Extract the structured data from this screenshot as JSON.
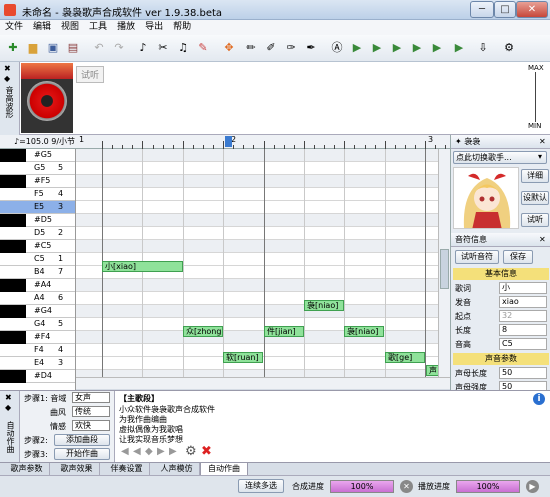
{
  "window": {
    "title": "未命名 - 袅袅歌声合成软件 ver 1.9.38.beta",
    "min": "─",
    "max": "□",
    "close": "✕"
  },
  "menu": [
    "文件",
    "编辑",
    "视图",
    "工具",
    "播放",
    "导出",
    "帮助"
  ],
  "wave": {
    "side_label": "音高波形",
    "audition_label": "试听",
    "max_label": "MAX",
    "min_label": "MIN"
  },
  "ruler": {
    "tempo": "♪=105.0  9/小节",
    "bars": [
      "1",
      "2",
      "3"
    ]
  },
  "piano_keys": [
    {
      "name": "#G5",
      "num": "",
      "black": true
    },
    {
      "name": "G5",
      "num": "5",
      "black": false
    },
    {
      "name": "#F5",
      "num": "",
      "black": true
    },
    {
      "name": "F5",
      "num": "4",
      "black": false
    },
    {
      "name": "E5",
      "num": "3",
      "black": false,
      "hl": true
    },
    {
      "name": "#D5",
      "num": "",
      "black": true
    },
    {
      "name": "D5",
      "num": "2",
      "black": false
    },
    {
      "name": "#C5",
      "num": "",
      "black": true
    },
    {
      "name": "C5",
      "num": "1",
      "black": false
    },
    {
      "name": "B4",
      "num": "7",
      "black": false
    },
    {
      "name": "#A4",
      "num": "",
      "black": true
    },
    {
      "name": "A4",
      "num": "6",
      "black": false
    },
    {
      "name": "#G4",
      "num": "",
      "black": true
    },
    {
      "name": "G4",
      "num": "5",
      "black": false
    },
    {
      "name": "#F4",
      "num": "",
      "black": true
    },
    {
      "name": "F4",
      "num": "4",
      "black": false
    },
    {
      "name": "E4",
      "num": "3",
      "black": false
    },
    {
      "name": "#D4",
      "num": "",
      "black": true
    }
  ],
  "notes": [
    {
      "text": "小[xiao]"
    },
    {
      "text": "袅[niao]"
    },
    {
      "text": "众[zhong]"
    },
    {
      "text": "件[jian]"
    },
    {
      "text": "袅[niao]"
    },
    {
      "text": "软[ruan]"
    },
    {
      "text": "歌[ge]"
    },
    {
      "text": "声"
    }
  ],
  "right_panel": {
    "singer_tab": "袅袅",
    "switch_singer": "点此切换歌手...",
    "btn_detail": "详细",
    "btn_default": "设默认",
    "btn_audition": "试听",
    "pitch_info": "音符信息",
    "btn_audition_pitch": "试听音符",
    "btn_save": "保存",
    "basic_info": "基本信息",
    "fields": [
      {
        "k": "歌词",
        "v": "小"
      },
      {
        "k": "发音",
        "v": "xiao"
      },
      {
        "k": "起点",
        "v": "32"
      },
      {
        "k": "长度",
        "v": "8"
      },
      {
        "k": "音高",
        "v": "C5"
      }
    ],
    "voice_params": "声音参数",
    "params": [
      {
        "k": "声母长度",
        "v": "50"
      },
      {
        "k": "声母强度",
        "v": "50"
      }
    ]
  },
  "bottom": {
    "side_label": "自动作曲",
    "step1": "步骤1: 音域",
    "range_val": "女声",
    "style": "曲风",
    "style_val": "传统",
    "emotion": "情感",
    "emotion_val": "欢快",
    "step2": "步骤2:",
    "add_lyrics": "添加曲段",
    "step3": "步骤3:",
    "start_compose": "开始作曲",
    "main_section": "【主歌段】",
    "lyrics": [
      "小众软件袅袅歌声合成软件",
      "为我作曲编曲",
      "虚拟偶像为我歌唱",
      "让我实现音乐梦想"
    ]
  },
  "tabs": [
    "歌声参数",
    "歌声效果",
    "伴奏设置",
    "人声模仿",
    "自动作曲"
  ],
  "status": {
    "select_mode": "连续多选",
    "synth_progress": "合成进度",
    "synth_value": "100%",
    "play_progress": "播放进度",
    "play_value": "100%"
  }
}
